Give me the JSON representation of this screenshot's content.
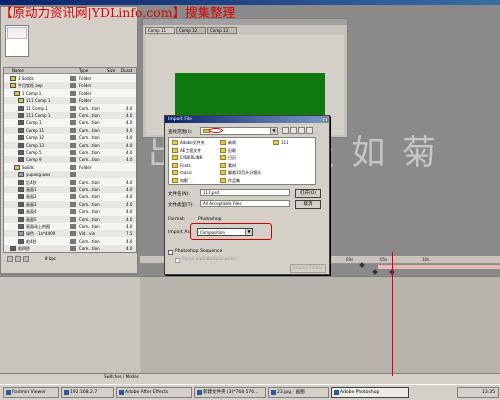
{
  "window": {
    "title": "Adobe After Effects"
  },
  "watermark_top": "【原动力资讯网|YDLinfo.com】搜集整理",
  "watermark_big": "出 素 蝶 淡 如 菊",
  "project": {
    "columns": [
      "Name",
      "Type",
      "Size",
      "Durat"
    ],
    "rows": [
      {
        "name": "3 Solids",
        "type": "Folder",
        "size": "",
        "icon": "folder",
        "indent": 6
      },
      {
        "name": "牛月农旺.aep",
        "type": "Folder",
        "size": "",
        "icon": "folder",
        "indent": 6
      },
      {
        "name": "1 Comp 1",
        "type": "Folder",
        "size": "",
        "icon": "folder",
        "indent": 10
      },
      {
        "name": "111 Comp 1",
        "type": "Folder",
        "size": "",
        "icon": "folder",
        "indent": 14
      },
      {
        "name": "11 Comp 1",
        "type": "Com...tion",
        "size": "4.0",
        "icon": "comp",
        "indent": 14
      },
      {
        "name": "111 Comp 1",
        "type": "Com...tion",
        "size": "4.0",
        "icon": "comp",
        "indent": 14
      },
      {
        "name": "Comp 1",
        "type": "Com...tion",
        "size": "4.0",
        "icon": "comp",
        "indent": 14
      },
      {
        "name": "Comp 11",
        "type": "Com...tion",
        "size": "4.0",
        "icon": "comp",
        "indent": 14
      },
      {
        "name": "Comp 12",
        "type": "Com...tion",
        "size": "4.0",
        "icon": "comp",
        "indent": 14
      },
      {
        "name": "Comp 13",
        "type": "Com...tion",
        "size": "4.0",
        "icon": "comp",
        "indent": 14
      },
      {
        "name": "Comp 5",
        "type": "Com...tion",
        "size": "4.0",
        "icon": "comp",
        "indent": 14
      },
      {
        "name": "Comp 9",
        "type": "Com...tion",
        "size": "4.0",
        "icon": "comp",
        "indent": 14
      },
      {
        "name": "Solids",
        "type": "Folder",
        "size": "",
        "icon": "folder",
        "indent": 10
      },
      {
        "name": "yupang.wav",
        "type": "",
        "size": "",
        "icon": "footage",
        "indent": 14
      },
      {
        "name": "后4秒",
        "type": "Com...tion",
        "size": "4.0",
        "icon": "comp",
        "indent": 14
      },
      {
        "name": "画面1",
        "type": "Com...tion",
        "size": "4.0",
        "icon": "comp",
        "indent": 14
      },
      {
        "name": "画面2",
        "type": "Com...tion",
        "size": "4.0",
        "icon": "comp",
        "indent": 14
      },
      {
        "name": "画面3",
        "type": "Com...tion",
        "size": "4.0",
        "icon": "comp",
        "indent": 14
      },
      {
        "name": "画面4",
        "type": "Com...tion",
        "size": "4.0",
        "icon": "comp",
        "indent": 14
      },
      {
        "name": "画面5",
        "type": "Com...tion",
        "size": "4.0",
        "icon": "comp",
        "indent": 14
      },
      {
        "name": "画面动上的图",
        "type": "Com...tion",
        "size": "4.0",
        "icon": "comp",
        "indent": 14
      },
      {
        "name": "绿色 - 1a*4409",
        "type": "Vid...vie",
        "size": "7.5",
        "icon": "footage",
        "indent": 14
      },
      {
        "name": "前4秒",
        "type": "Com...tion",
        "size": "4.0",
        "icon": "comp",
        "indent": 14
      },
      {
        "name": "前四秒",
        "type": "Com...tion",
        "size": "4.0",
        "icon": "comp",
        "indent": 6
      }
    ],
    "bpc": "8 bpc"
  },
  "comp": {
    "tabs": [
      "Comp 11",
      "Comp 12",
      "Comp 13"
    ]
  },
  "timeline": {
    "ruler_labels": [
      "00s",
      "05s",
      "10s"
    ],
    "switches_label": "Switches / Modes"
  },
  "dialog": {
    "title": "Import File",
    "close": "×",
    "look_in_label": "查找范围(I):",
    "files": [
      {
        "name": "Adobe文件夹",
        "col": 0,
        "row": 0
      },
      {
        "name": "AE工程文件",
        "col": 0,
        "row": 1
      },
      {
        "name": "CYBERLINK",
        "col": 0,
        "row": 2
      },
      {
        "name": "Fonts",
        "col": 0,
        "row": 3
      },
      {
        "name": "music",
        "col": 0,
        "row": 4
      },
      {
        "name": "电影",
        "col": 0,
        "row": 5
      },
      {
        "name": "新闻",
        "col": 1,
        "row": 0
      },
      {
        "name": "旧歌",
        "col": 1,
        "row": 1
      },
      {
        "name": "日历",
        "col": 1,
        "row": 2
      },
      {
        "name": "素材",
        "col": 1,
        "row": 3
      },
      {
        "name": "飘渺10月头分镜头",
        "col": 1,
        "row": 4
      },
      {
        "name": "作品集",
        "col": 1,
        "row": 5
      },
      {
        "name": "111",
        "col": 2,
        "row": 0
      }
    ],
    "filename_label": "文件名(N):",
    "filename_value": "111.psd",
    "filetype_label": "文件类型(T):",
    "filetype_value": "All Acceptable Files",
    "open_button": "打开(O)",
    "cancel_button": "取消",
    "format_label": "Format:",
    "format_value": "Photoshop",
    "import_as_label": "Import As:",
    "import_as_value": "Composition",
    "sequence_label": "Photoshop Sequence",
    "force_alpha_label": "Force alphabetical order",
    "import_folder_button": "Import Folder"
  },
  "taskbar": {
    "tasks": [
      {
        "label": "Radmin Viewer",
        "active": false
      },
      {
        "label": "192.168.2.7",
        "active": false
      },
      {
        "label": "Adobe After Effects",
        "active": false
      },
      {
        "label": "新建文件夹 (3)*768 576...",
        "active": false
      },
      {
        "label": "23.jpg - 画图",
        "active": false
      },
      {
        "label": "Adobe Photoshop",
        "active": true
      }
    ],
    "time": "13:35"
  }
}
